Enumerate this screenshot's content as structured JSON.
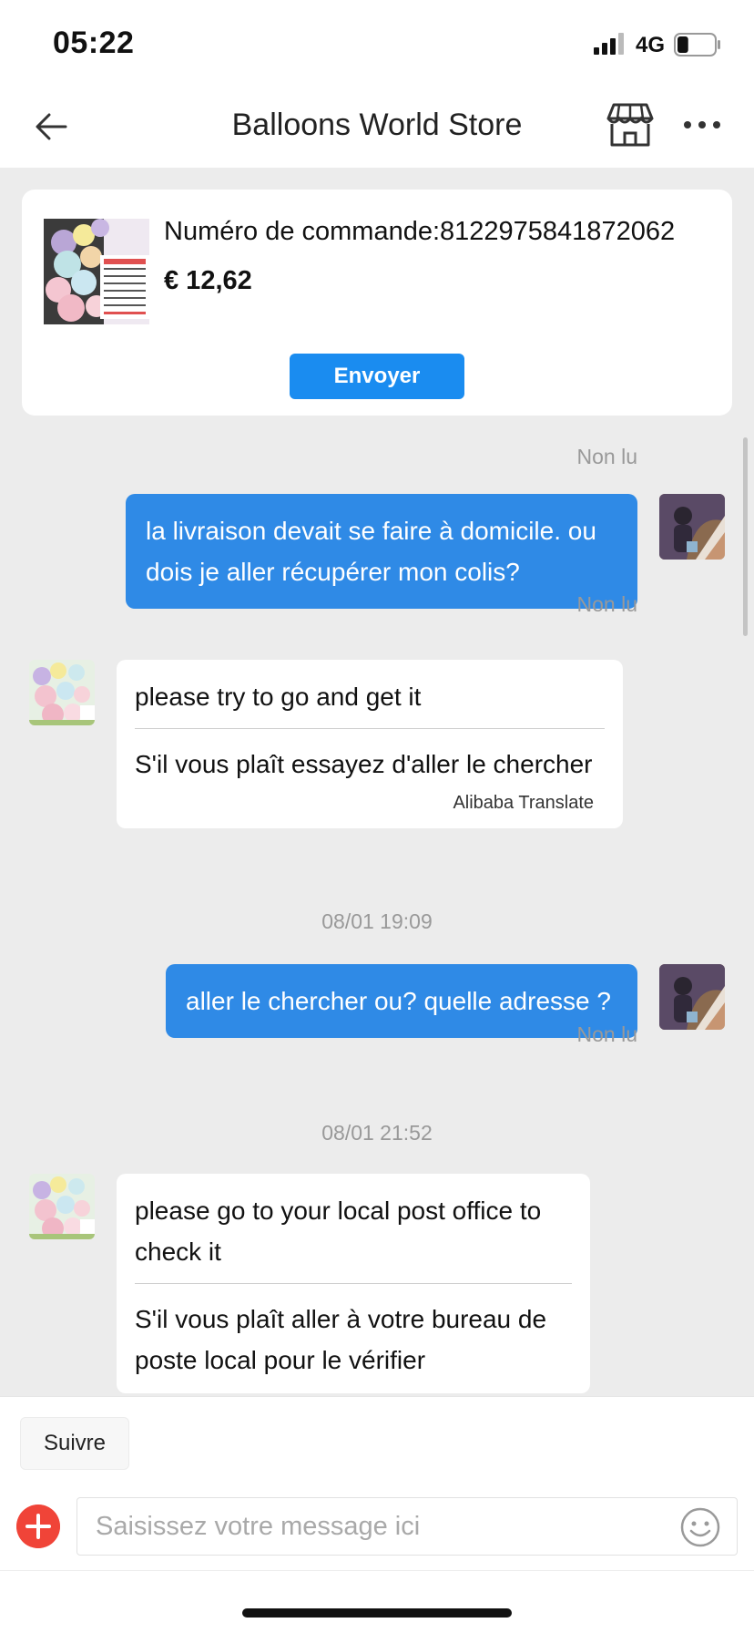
{
  "status_bar": {
    "time": "05:22",
    "network": "4G",
    "battery_level": 0.3
  },
  "header": {
    "title": "Balloons World Store",
    "back_icon": "arrow-left-icon",
    "store_icon": "storefront-icon",
    "more_icon": "more-horizontal-icon"
  },
  "order": {
    "number_text": "Numéro de commande:8122975841872062",
    "price": "€ 12,62",
    "send_label": "Envoyer",
    "accent_color": "#1a8cf0"
  },
  "chat": {
    "messages": [
      {
        "side": "out",
        "text": "la livraison devait se faire à domicile. ou dois je aller récupérer mon colis?",
        "status": "Non lu"
      },
      {
        "side": "in",
        "original": "please try to go and get it",
        "translated": "S'il vous plaît essayez d'aller le chercher",
        "credit": "Alibaba Translate"
      },
      {
        "timestamp": "08/01 19:09"
      },
      {
        "side": "out",
        "text": "aller le chercher ou? quelle adresse ?",
        "status": "Non lu"
      },
      {
        "timestamp": "08/01 21:52"
      },
      {
        "side": "in",
        "original": "please go to your local post office to check it",
        "translated": "S'il vous plaît aller à votre bureau de poste local pour le vérifier"
      }
    ],
    "top_status": "Non lu",
    "outgoing_color": "#2f8ae6"
  },
  "composer": {
    "follow_label": "Suivre",
    "placeholder": "Saisissez votre message ici",
    "add_icon": "plus-circle-icon",
    "emoji_icon": "smiley-icon"
  }
}
